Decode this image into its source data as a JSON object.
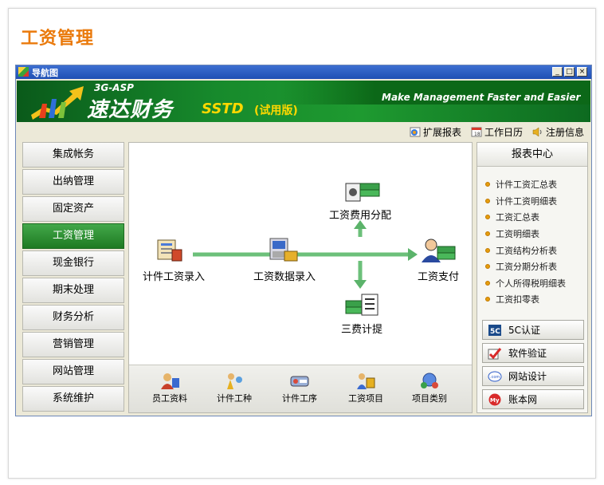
{
  "page": {
    "title": "工资管理"
  },
  "window": {
    "title": "导航图",
    "controls": {
      "minimize": "_",
      "restore": "□",
      "close": "×"
    }
  },
  "banner": {
    "subtitle": "3G-ASP",
    "product_name": "速达财务",
    "edition": "SSTD",
    "trial_tag": "(试用版)",
    "slogan": "Make Management Faster and Easier"
  },
  "top_links": [
    {
      "label": "扩展报表",
      "icon": "globe-report-icon"
    },
    {
      "label": "工作日历",
      "icon": "calendar-icon"
    },
    {
      "label": "注册信息",
      "icon": "speaker-icon"
    }
  ],
  "left_nav": {
    "items": [
      {
        "label": "集成帐务"
      },
      {
        "label": "出纳管理"
      },
      {
        "label": "固定资产"
      },
      {
        "label": "工资管理",
        "active": true
      },
      {
        "label": "现金银行"
      },
      {
        "label": "期末处理"
      },
      {
        "label": "财务分析"
      },
      {
        "label": "营销管理"
      },
      {
        "label": "网站管理"
      },
      {
        "label": "系统维护"
      }
    ]
  },
  "flow": {
    "nodes": {
      "piece_entry": "计件工资录入",
      "data_entry": "工资数据录入",
      "cost_alloc": "工资费用分配",
      "payment": "工资支付",
      "three_fees": "三费计提"
    }
  },
  "bottom_tools": [
    {
      "label": "员工资料",
      "icon": "employee-icon"
    },
    {
      "label": "计件工种",
      "icon": "worker-icon"
    },
    {
      "label": "计件工序",
      "icon": "process-icon"
    },
    {
      "label": "工资项目",
      "icon": "salary-item-icon"
    },
    {
      "label": "项目类别",
      "icon": "category-icon"
    }
  ],
  "report_center": {
    "title": "报表中心",
    "items": [
      "计件工资汇总表",
      "计件工资明细表",
      "工资汇总表",
      "工资明细表",
      "工资结构分析表",
      "工资分期分析表",
      "个人所得税明细表",
      "工资扣零表"
    ],
    "buttons": [
      {
        "label": "5C认证",
        "icon": "5c-icon"
      },
      {
        "label": "软件验证",
        "icon": "check-icon"
      },
      {
        "label": "网站设计",
        "icon": "com-icon"
      },
      {
        "label": "账本网",
        "icon": "my-icon"
      }
    ]
  },
  "colors": {
    "title_orange": "#ea7a0c",
    "banner_green": "#178a2c",
    "active_nav": "#2e8f34",
    "flow_arrow": "#6cc07a",
    "bullet": "#e69d0c"
  }
}
